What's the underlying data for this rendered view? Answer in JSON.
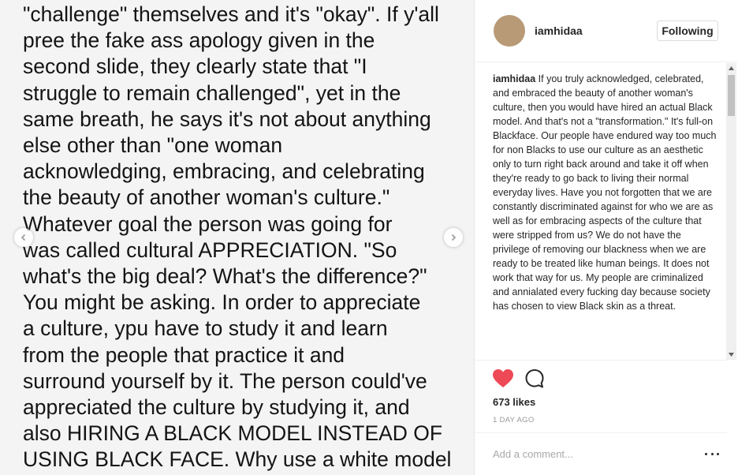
{
  "post_image": {
    "text": "\"challenge\" themselves and it's \"okay\". If y'all\npree the fake ass apology given in the\nsecond slide, they clearly state that \"I\nstruggle to remain challenged\", yet in the\nsame breath, he says it's not about anything\nelse other than \"one woman\nacknowledging, embracing, and celebrating\nthe beauty of another woman's culture.\"\nWhatever goal the person was going for\nwas called cultural APPRECIATION. \"So\nwhat's the big deal? What's the difference?\"\nYou might be asking. In order to appreciate\na culture, ypu have to study it and learn\nfrom the people that practice it and\nsurround yourself by it. The person could've\nappreciated the culture by studying it, and\nalso HIRING A BLACK MODEL INSTEAD OF\nUSING BLACK FACE. Why use a white model",
    "prev_icon": "chevron-left-icon",
    "next_icon": "chevron-right-icon"
  },
  "header": {
    "username": "iamhidaa",
    "follow_label": "Following"
  },
  "caption": {
    "username": "iamhidaa",
    "text": "If you truly acknowledged, celebrated, and embraced the beauty of another woman's culture, then you would have hired an actual Black model. And that's not a \"transformation.\" It's full-on Blackface. Our people have endured way too much for non Blacks to use our culture as an aesthetic only to turn right back around and take it off when they're ready to go back to living their normal everyday lives. Have you not forgotten that we are constantly discriminated against for who we are as well as for embracing aspects of the culture that were stripped from us? We do not have the privilege of removing our blackness when we are ready to be treated like human beings. It does not work that way for us. My people are criminalized and annialated every fucking day because society has chosen to view Black skin as a threat."
  },
  "actions": {
    "like_icon": "heart-icon",
    "comment_icon": "comment-icon",
    "likes": "673 likes",
    "timestamp": "1 DAY AGO",
    "like_color": "#ed4956"
  },
  "comment_box": {
    "placeholder": "Add a comment...",
    "more_icon": "more-options-icon"
  }
}
